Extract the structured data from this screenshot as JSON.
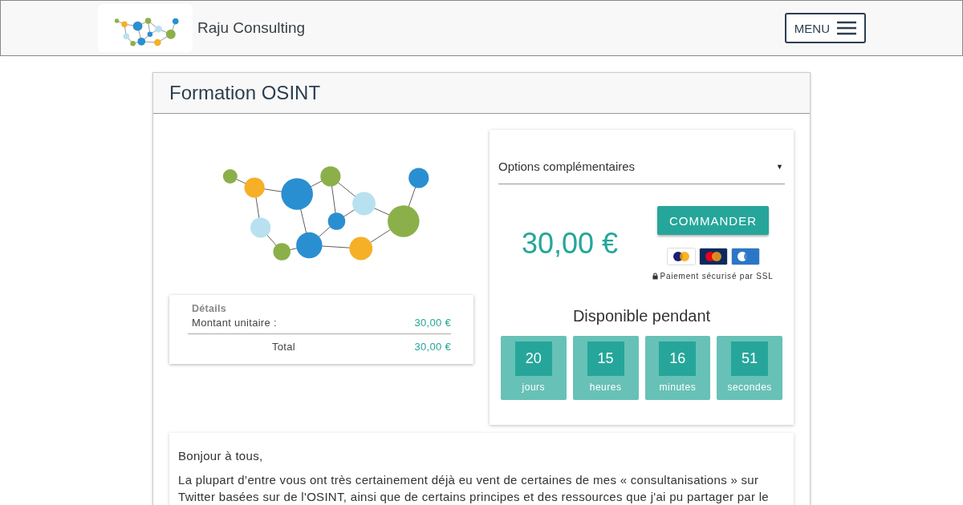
{
  "header": {
    "brand": "Raju Consulting",
    "menu_button": "MENU"
  },
  "course": {
    "title": "Formation OSINT",
    "details": {
      "heading": "Détails",
      "rows": [
        {
          "label": "Montant unitaire :",
          "value": "30,00 €"
        }
      ],
      "total": {
        "label": "Total",
        "value": "30,00 €"
      }
    },
    "options": {
      "label": "Options complémentaires",
      "caret": "▼",
      "expanded": false
    },
    "price": "30,00 €",
    "order_button": "COMMANDER",
    "payment_note": "Paiement sécurisé par SSL",
    "availability": {
      "title": "Disponible pendant",
      "countdown": [
        {
          "value": "20",
          "unit": "jours"
        },
        {
          "value": "15",
          "unit": "heures"
        },
        {
          "value": "16",
          "unit": "minutes"
        },
        {
          "value": "51",
          "unit": "secondes"
        }
      ]
    },
    "description": [
      "Bonjour à tous,",
      "La plupart d’entre vous ont très certainement déjà eu vent de certaines de mes « consultanisations » sur Twitter basées sur de l'OSINT, ainsi que de certains principes et des ressources que j'ai pu partager par le"
    ]
  }
}
